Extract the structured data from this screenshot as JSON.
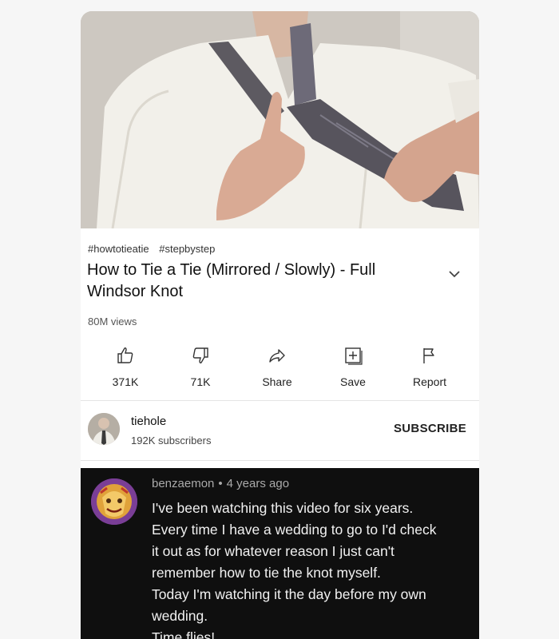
{
  "video": {
    "hashtags": [
      "#howtotieatie",
      "#stepbystep"
    ],
    "title": "How to Tie a Tie (Mirrored / Slowly) - Full Windsor Knot",
    "views": "80M views"
  },
  "actions": {
    "like_label": "371K",
    "dislike_label": "71K",
    "share_label": "Share",
    "save_label": "Save",
    "report_label": "Report"
  },
  "channel": {
    "name": "tiehole",
    "subscribers": "192K subscribers",
    "subscribe_label": "SUBSCRIBE"
  },
  "comment": {
    "author": "benzaemon",
    "separator": "•",
    "time": "4 years ago",
    "lines": [
      "I've been watching this video for six years.",
      "Every time I have a wedding to go to I'd check",
      "it out as for whatever reason I just can't",
      "remember how to tie the knot myself.",
      "Today I'm watching it the day before my own",
      "wedding.",
      "Time flies!"
    ]
  },
  "icons": {
    "like": "thumbs-up-icon",
    "dislike": "thumbs-down-icon",
    "share": "share-arrow-icon",
    "save": "add-to-playlist-icon",
    "report": "flag-icon",
    "expand": "chevron-down-icon"
  },
  "colors": {
    "comment_background": "#0f0f0f",
    "comment_text": "#f1f1f1",
    "meta_text": "#aaaaaa"
  }
}
